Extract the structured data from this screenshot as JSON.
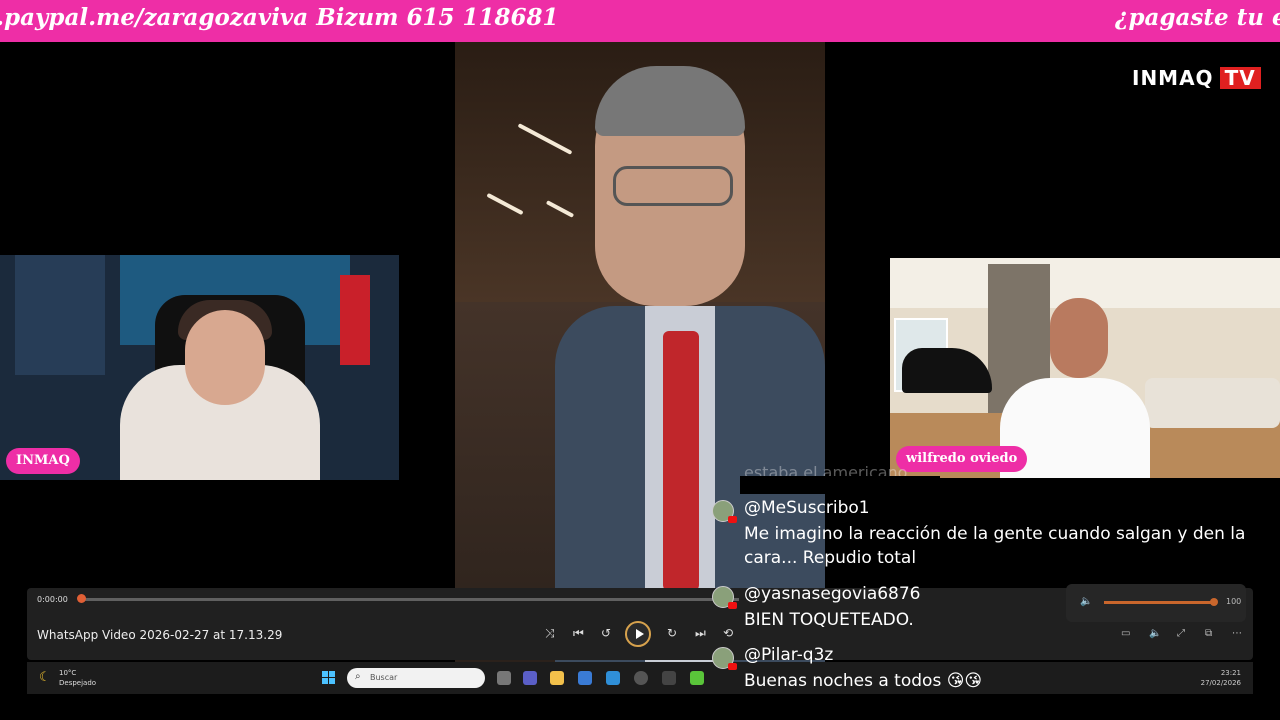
{
  "ticker": {
    "text_left": ".paypal.me/zaragozaviva Bizum 615 118681",
    "text_right": "¿pagaste tu ent"
  },
  "brand": {
    "name": "INMAQ",
    "tv": "TV"
  },
  "cams": {
    "left_name": "INMAQ",
    "right_name": "wilfredo oviedo"
  },
  "player": {
    "time": "0:00:00",
    "title": "WhatsApp Video 2026-02-27 at 17.13.29",
    "volume": "100",
    "progress": 0.0
  },
  "taskbar": {
    "weather_temp": "10°C",
    "weather_desc": "Despejado",
    "search_placeholder": "Buscar",
    "clock_time": "23:21",
    "clock_date": "27/02/2026"
  },
  "chat": {
    "faded_text": "estaba el americano",
    "messages": [
      {
        "user": "@MeSuscribo1",
        "text": "Me imagino la reacción de la gente cuando salgan y den la cara... Repudio total"
      },
      {
        "user": "@yasnasegovia6876",
        "text": "BIEN TOQUETEADO."
      },
      {
        "user": "@Pilar-q3z",
        "text": "Buenas noches a todos 😘😘"
      }
    ]
  },
  "colors": {
    "accent": "#ee2ea6",
    "brand_red": "#e02020"
  }
}
